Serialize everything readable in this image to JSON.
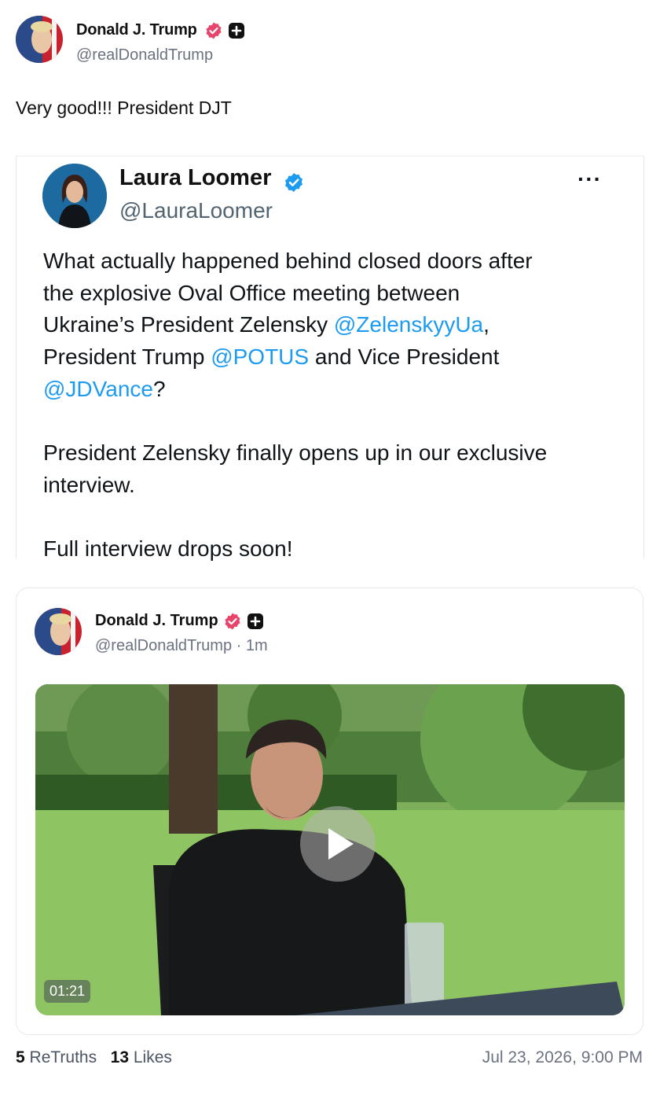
{
  "post": {
    "author_name": "Donald J. Trump",
    "author_handle": "@realDonaldTrump",
    "text": "Very good!!! President DJT"
  },
  "quoted_x_post": {
    "author_name": "Laura Loomer",
    "author_handle": "@LauraLoomer",
    "more_label": "···",
    "line1": "What actually happened behind closed doors after",
    "line2": "the explosive Oval Office meeting between",
    "line3_text": "Ukraine’s President Zelensky ",
    "line3_mention": "@ZelenskyyUa",
    "line3_end": ",",
    "line4_text": "President Trump ",
    "line4_mention": "@POTUS",
    "line4_end": " and Vice President",
    "line5_mention": "@JDVance",
    "line5_end": "?",
    "line6": "President Zelensky finally opens up in our exclusive",
    "line7": "interview.",
    "line8": "Full interview drops soon!"
  },
  "embedded_truth": {
    "author_name": "Donald J. Trump",
    "author_meta": "@realDonaldTrump · 1m",
    "video_duration": "01:21"
  },
  "footer": {
    "retruths_count": "5",
    "retruths_label": "ReTruths",
    "likes_count": "13",
    "likes_label": "Likes",
    "timestamp": "Jul 23, 2026, 9:00 PM"
  },
  "colors": {
    "verified_badge": "#e8436a",
    "x_verified": "#1d9bf0",
    "mention": "#1d9bf0"
  },
  "icons": [
    "verified-badge-icon",
    "plus-badge-icon",
    "x-verified-icon",
    "more-icon",
    "play-icon"
  ]
}
